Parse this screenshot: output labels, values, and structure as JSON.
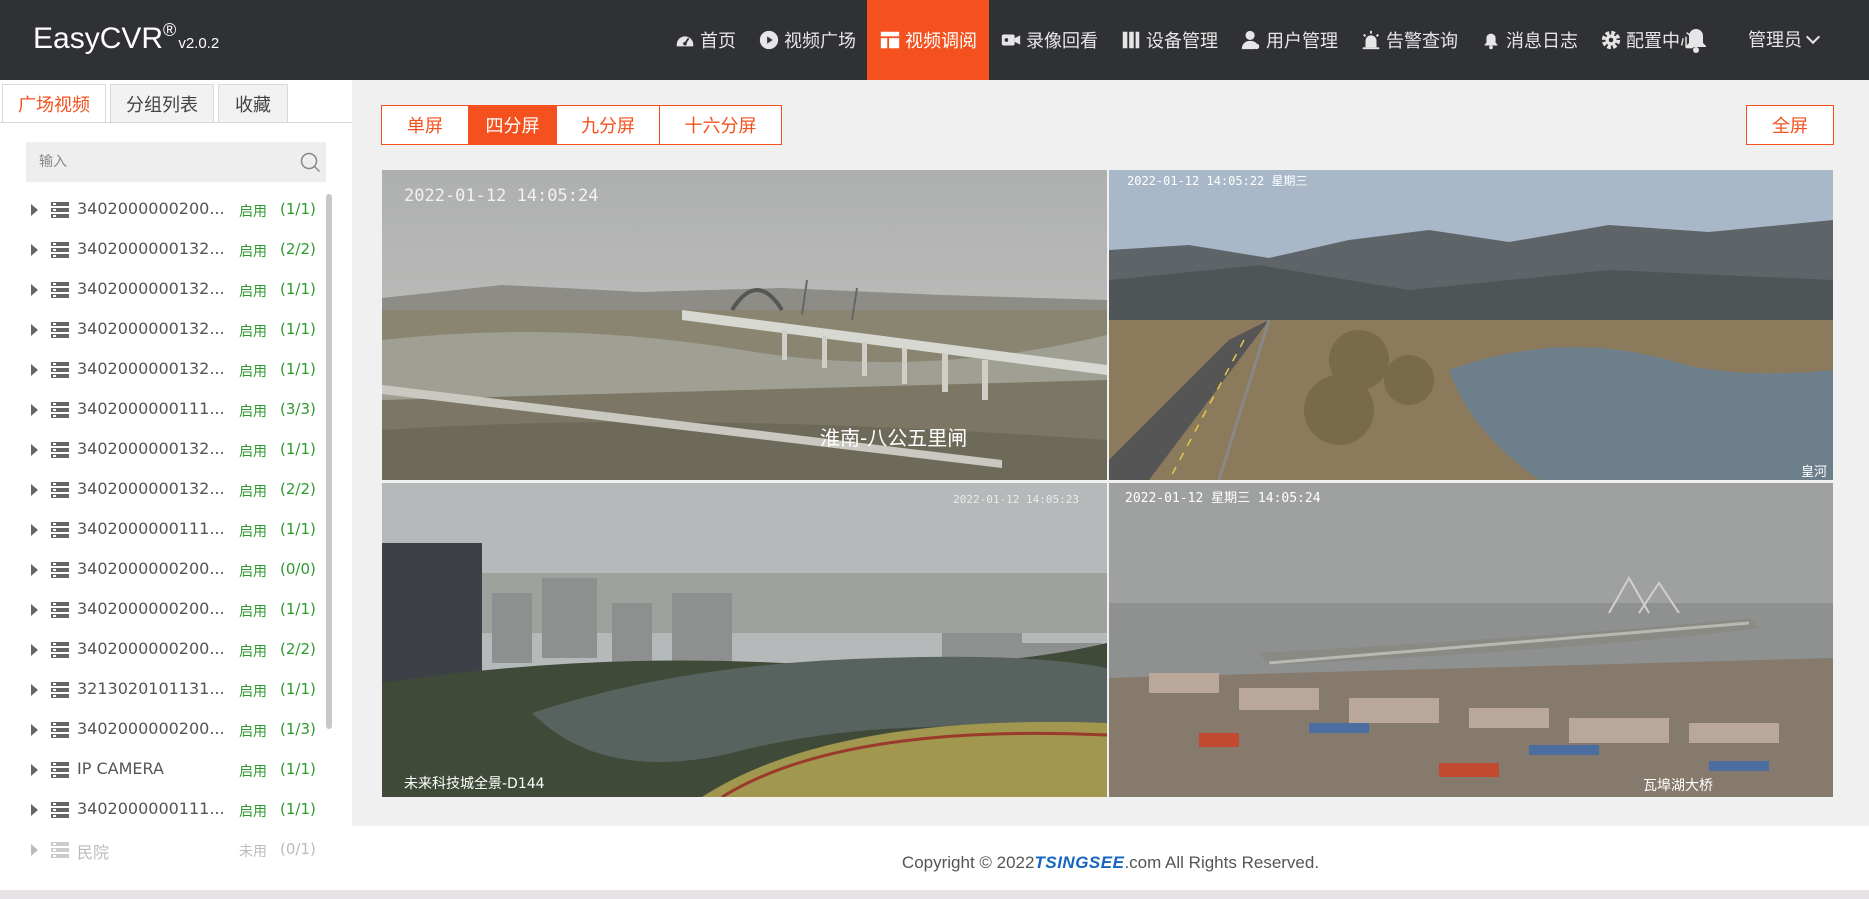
{
  "brand": {
    "name": "EasyCVR",
    "reg": "®",
    "version": "v2.0.2"
  },
  "nav": {
    "items": [
      {
        "label": "首页",
        "icon": "dashboard-icon"
      },
      {
        "label": "视频广场",
        "icon": "play-circle-icon"
      },
      {
        "label": "视频调阅",
        "icon": "layout-icon",
        "active": true
      },
      {
        "label": "录像回看",
        "icon": "video-camera-icon"
      },
      {
        "label": "设备管理",
        "icon": "server-icon"
      },
      {
        "label": "用户管理",
        "icon": "user-icon"
      },
      {
        "label": "告警查询",
        "icon": "alarm-icon"
      },
      {
        "label": "消息日志",
        "icon": "bell-icon"
      },
      {
        "label": "配置中心",
        "icon": "gear-icon"
      }
    ],
    "user": "管理员"
  },
  "sidebar": {
    "tabs": [
      "广场视频",
      "分组列表",
      "收藏"
    ],
    "search_placeholder": "输入",
    "items": [
      {
        "label": "3402000000200...",
        "status": "启用",
        "count": "(1/1)"
      },
      {
        "label": "3402000000132...",
        "status": "启用",
        "count": "(2/2)"
      },
      {
        "label": "3402000000132...",
        "status": "启用",
        "count": "(1/1)"
      },
      {
        "label": "3402000000132...",
        "status": "启用",
        "count": "(1/1)"
      },
      {
        "label": "3402000000132...",
        "status": "启用",
        "count": "(1/1)"
      },
      {
        "label": "3402000000111...",
        "status": "启用",
        "count": "(3/3)"
      },
      {
        "label": "3402000000132...",
        "status": "启用",
        "count": "(1/1)"
      },
      {
        "label": "3402000000132...",
        "status": "启用",
        "count": "(2/2)"
      },
      {
        "label": "3402000000111...",
        "status": "启用",
        "count": "(1/1)"
      },
      {
        "label": "3402000000200...",
        "status": "启用",
        "count": "(0/0)"
      },
      {
        "label": "3402000000200...",
        "status": "启用",
        "count": "(1/1)"
      },
      {
        "label": "3402000000200...",
        "status": "启用",
        "count": "(2/2)"
      },
      {
        "label": "3213020101131...",
        "status": "启用",
        "count": "(1/1)"
      },
      {
        "label": "3402000000200...",
        "status": "启用",
        "count": "(1/3)"
      },
      {
        "label": "IP CAMERA",
        "status": "启用",
        "count": "(1/1)"
      },
      {
        "label": "3402000000111...",
        "status": "启用",
        "count": "(1/1)"
      },
      {
        "label": "民院",
        "status": "未用",
        "count": "(0/1)",
        "disabled": true
      }
    ]
  },
  "split": {
    "options": [
      "单屏",
      "四分屏",
      "九分屏",
      "十六分屏"
    ],
    "active_index": 1,
    "fullscreen": "全屏"
  },
  "videos": [
    {
      "timestamp": "2022-01-12  14:05:24",
      "caption": "淮南-八公五里闸"
    },
    {
      "timestamp": "2022-01-12 14:05:22 星期三",
      "caption": "皇河"
    },
    {
      "timestamp": "2022-01-12 14:05:23",
      "caption": "未来科技城全景-D144"
    },
    {
      "timestamp": "2022-01-12  星期三  14:05:24",
      "caption": "瓦埠湖大桥"
    }
  ],
  "footer": {
    "prefix": "Copyright © 2022 ",
    "logo": "TSINGSEE",
    "suffix": ".com All Rights Reserved."
  },
  "colors": {
    "accent": "#f4511e",
    "topbar": "#2f3135",
    "enabled": "#2e9a2e"
  }
}
